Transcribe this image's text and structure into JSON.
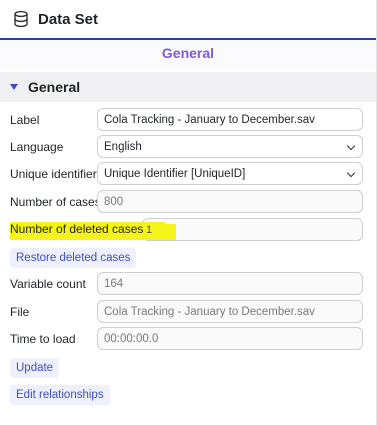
{
  "header": {
    "title": "Data Set",
    "icon": "database-icon"
  },
  "tabs": [
    {
      "label": "General"
    }
  ],
  "section": {
    "title": "General"
  },
  "form": {
    "label": {
      "label": "Label",
      "value": "Cola Tracking - January to December.sav"
    },
    "language": {
      "label": "Language",
      "value": "English"
    },
    "unique_identifier": {
      "label": "Unique identifier",
      "value": "Unique Identifier [UniqueID]"
    },
    "number_of_cases": {
      "label": "Number of cases",
      "value": "800"
    },
    "number_of_deleted_cases": {
      "label": "Number of deleted cases",
      "value": "1"
    },
    "restore_button": "Restore deleted cases",
    "variable_count": {
      "label": "Variable count",
      "value": "164"
    },
    "file": {
      "label": "File",
      "value": "Cola Tracking - January to December.sav"
    },
    "time_to_load": {
      "label": "Time to load",
      "value": "00:00:00.0"
    },
    "update_button": "Update",
    "edit_relationships_button": "Edit relationships"
  },
  "colors": {
    "accent": "#2f3ab2",
    "tab_text": "#7b5ad6",
    "button_text": "#3d4fc0",
    "highlight": "#f5f31a"
  }
}
